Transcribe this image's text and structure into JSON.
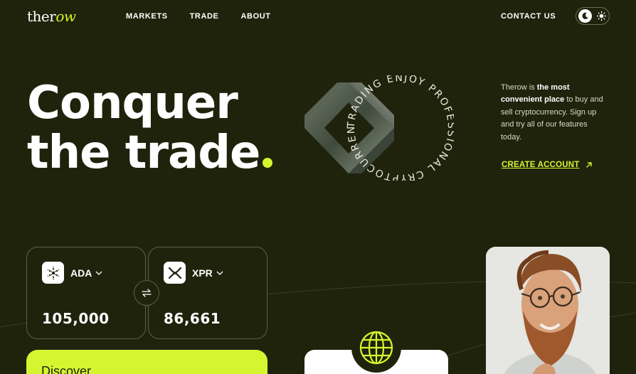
{
  "header": {
    "logo_text_main": "ther",
    "logo_text_accent": "ow",
    "nav": [
      "MARKETS",
      "TRADE",
      "ABOUT"
    ],
    "contact_label": "CONTACT US"
  },
  "hero": {
    "title_line1": "Conquer",
    "title_line2": "the trade"
  },
  "emblem": {
    "circular_text": "TRADING ENJOY PROFESSIONAL CRYPTOCURRENCY"
  },
  "intro": {
    "prefix": "Therow ",
    "is": "is ",
    "bold": "the most convenient place",
    "rest": " to buy and sell cryptocurrency. Sign up and try all of our features today.",
    "cta": "CREATE ACCOUNT"
  },
  "converter": {
    "from": {
      "symbol": "ADA",
      "amount": "105,000",
      "icon": "cardano-icon"
    },
    "to": {
      "symbol": "XPR",
      "amount": "86,661",
      "icon": "xrp-icon"
    }
  },
  "discover": {
    "label": "Discover"
  },
  "colors": {
    "background": "#20230c",
    "accent": "#d6f531",
    "text": "#ffffff",
    "muted_border": "#5d6146"
  }
}
